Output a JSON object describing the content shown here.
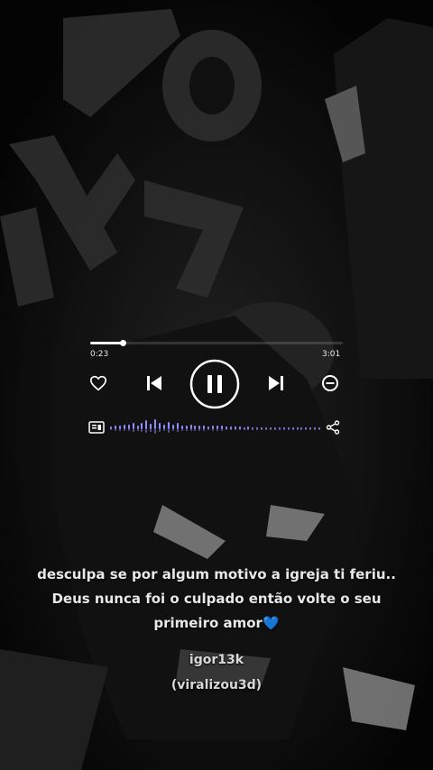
{
  "player": {
    "time_elapsed": "0:23",
    "time_total": "3:01",
    "progress_fraction": 0.13,
    "controls": {
      "like": "heart-icon",
      "previous": "skip-previous-icon",
      "play_pause": "pause-icon",
      "next": "skip-next-icon",
      "remove": "minus-circle-icon",
      "lyrics": "lyrics-card-icon",
      "share": "share-icon"
    },
    "waveform_levels": [
      0.25,
      0.35,
      0.3,
      0.45,
      0.4,
      0.6,
      0.35,
      0.55,
      0.8,
      0.5,
      0.95,
      0.6,
      0.45,
      0.7,
      0.4,
      0.55,
      0.35,
      0.3,
      0.45,
      0.3,
      0.35,
      0.3,
      0.25,
      0.35,
      0.3,
      0.3,
      0.25,
      0.28,
      0.22,
      0.25,
      0.2,
      0.22,
      0.2,
      0.18,
      0.2,
      0.18,
      0.15,
      0.18,
      0.16,
      0.15,
      0.15,
      0.14,
      0.14,
      0.13,
      0.13,
      0.12,
      0.12,
      0.12
    ],
    "accent_color": "#8f8cff"
  },
  "caption": {
    "line1": "desculpa se por algum motivo a igreja ti feriu..",
    "line2": "Deus nunca foi o culpado então volte o seu",
    "line3": "primeiro amor",
    "emoji": "💙"
  },
  "credits": {
    "author": "igor13k",
    "tag": "(viralizou3d)"
  }
}
